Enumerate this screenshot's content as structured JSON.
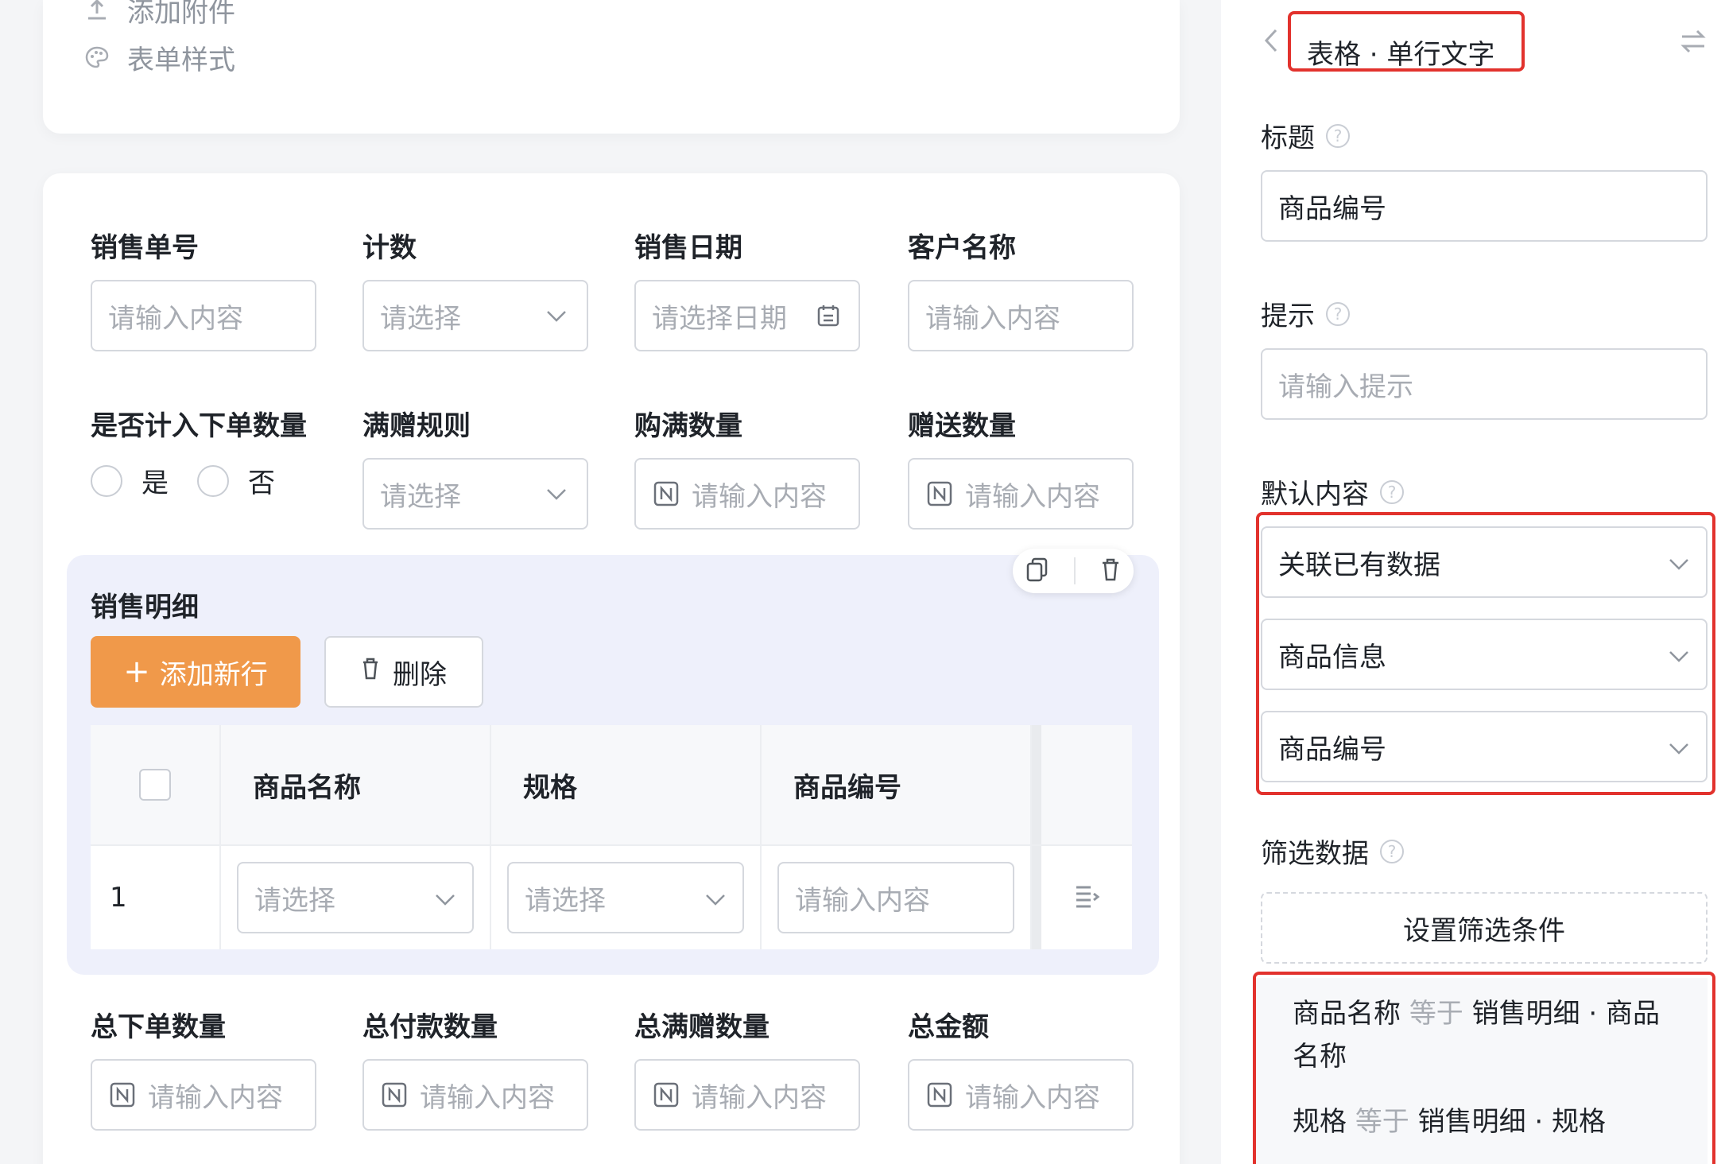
{
  "top_menu": [
    {
      "label": "添加附件",
      "icon": "upload-icon"
    },
    {
      "label": "表单样式",
      "icon": "palette-icon"
    }
  ],
  "form": {
    "fields_row1": [
      {
        "label": "销售单号",
        "placeholder": "请输入内容",
        "kind": "text"
      },
      {
        "label": "计数",
        "placeholder": "请选择",
        "kind": "select"
      },
      {
        "label": "销售日期",
        "placeholder": "请选择日期",
        "kind": "date"
      },
      {
        "label": "客户名称",
        "placeholder": "请输入内容",
        "kind": "text"
      }
    ],
    "fields_row2": [
      {
        "label": "是否计入下单数量",
        "kind": "radio",
        "options": [
          "是",
          "否"
        ]
      },
      {
        "label": "满赠规则",
        "placeholder": "请选择",
        "kind": "select"
      },
      {
        "label": "购满数量",
        "placeholder": "请输入内容",
        "kind": "number"
      },
      {
        "label": "赠送数量",
        "placeholder": "请输入内容",
        "kind": "number"
      }
    ],
    "subtable": {
      "title": "销售明细",
      "add_label": "添加新行",
      "delete_label": "删除",
      "columns": [
        "商品名称",
        "规格",
        "商品编号"
      ],
      "rows": [
        {
          "index": "1",
          "cells": [
            {
              "placeholder": "请选择",
              "kind": "select"
            },
            {
              "placeholder": "请选择",
              "kind": "select"
            },
            {
              "placeholder": "请输入内容",
              "kind": "text"
            }
          ]
        }
      ]
    },
    "fields_row3": [
      {
        "label": "总下单数量",
        "placeholder": "请输入内容",
        "kind": "number"
      },
      {
        "label": "总付款数量",
        "placeholder": "请输入内容",
        "kind": "number"
      },
      {
        "label": "总满赠数量",
        "placeholder": "请输入内容",
        "kind": "number"
      },
      {
        "label": "总金额",
        "placeholder": "请输入内容",
        "kind": "number"
      }
    ]
  },
  "panel": {
    "breadcrumb": "表格 · 单行文字",
    "title_label": "标题",
    "title_value": "商品编号",
    "hint_label": "提示",
    "hint_placeholder": "请输入提示",
    "default_label": "默认内容",
    "default_selects": [
      "关联已有数据",
      "商品信息",
      "商品编号"
    ],
    "filter_label": "筛选数据",
    "filter_button": "设置筛选条件",
    "conditions": [
      {
        "field": "商品名称",
        "op": "等于",
        "value": "销售明细 · 商品名称"
      },
      {
        "field": "规格",
        "op": "等于",
        "value": "销售明细 · 规格"
      }
    ]
  },
  "colors": {
    "accent": "#f0994a",
    "highlight": "#e2322d",
    "section_bg": "#eef0fb"
  }
}
